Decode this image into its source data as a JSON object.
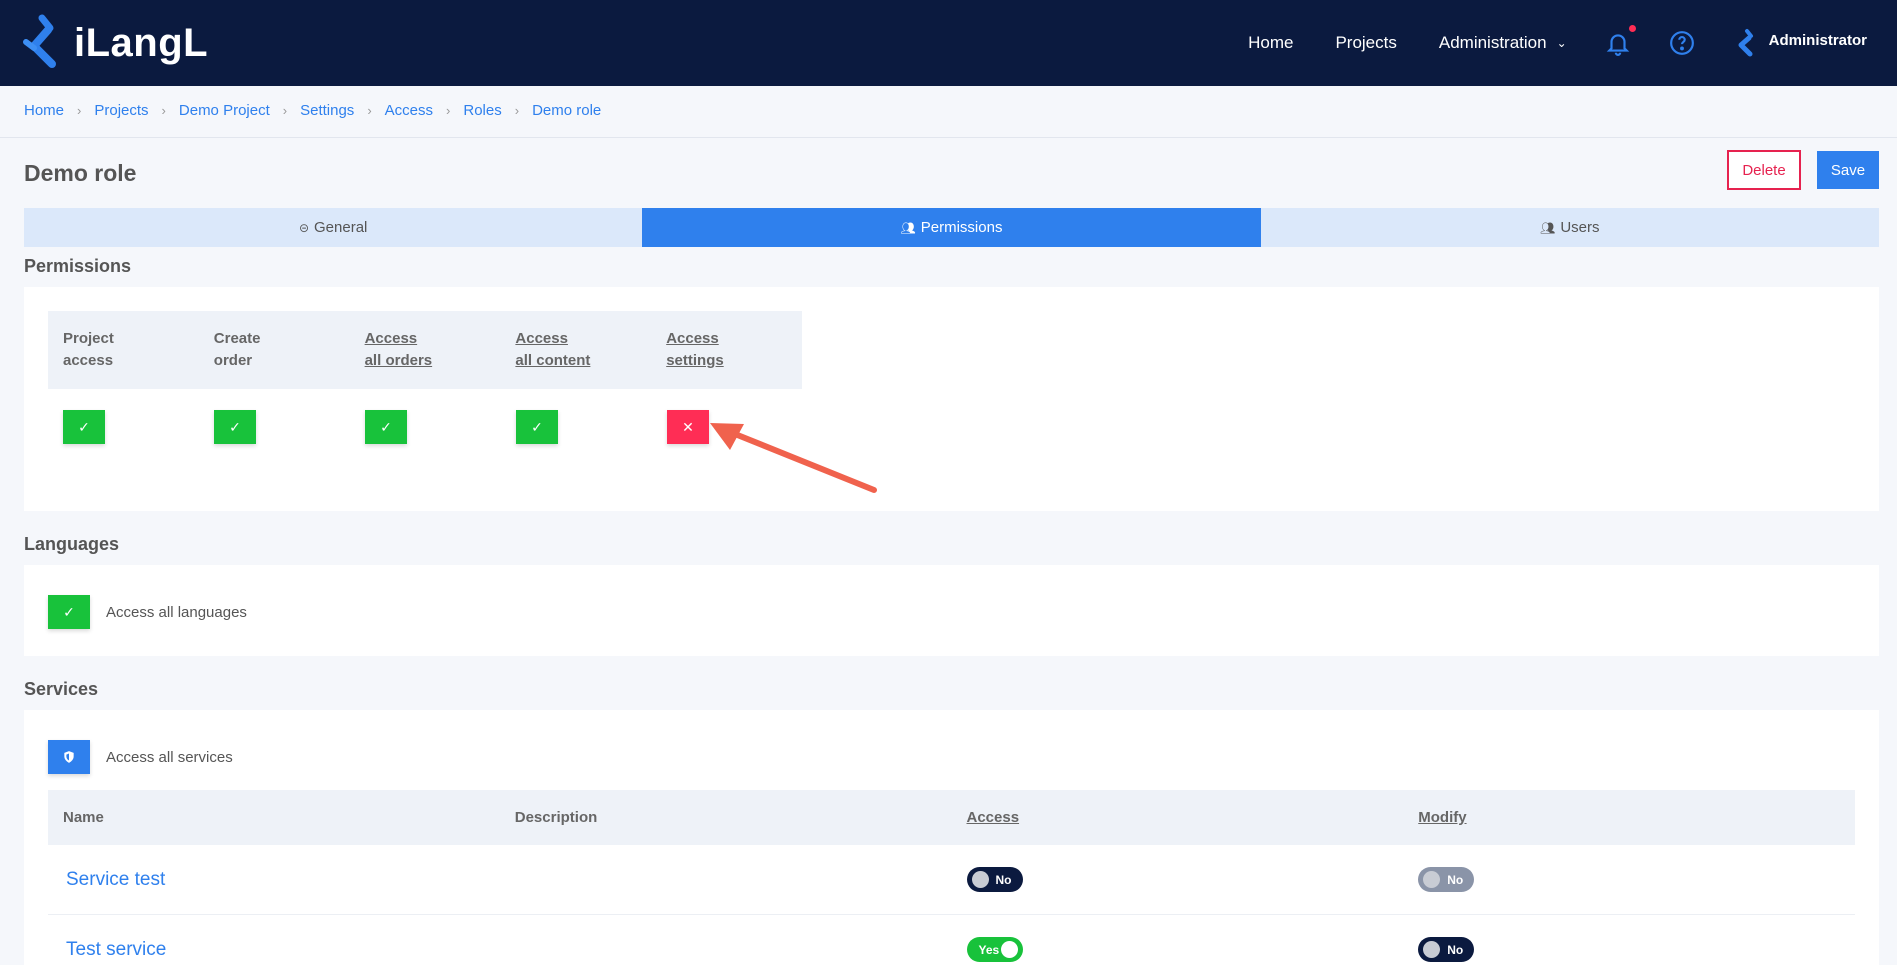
{
  "app": {
    "logo_text": "iLangL"
  },
  "nav": {
    "home": "Home",
    "projects": "Projects",
    "administration": "Administration",
    "user": "Administrator"
  },
  "breadcrumb": [
    "Home",
    "Projects",
    "Demo Project",
    "Settings",
    "Access",
    "Roles",
    "Demo role"
  ],
  "page": {
    "title": "Demo role",
    "delete_label": "Delete",
    "save_label": "Save"
  },
  "tabs": [
    {
      "label": "General",
      "active": false
    },
    {
      "label": "Permissions",
      "active": true
    },
    {
      "label": "Users",
      "active": false
    }
  ],
  "permissions": {
    "section_title": "Permissions",
    "columns": [
      {
        "line1": "Project",
        "line2": "access",
        "granted": true
      },
      {
        "line1": "Create",
        "line2": "order",
        "granted": true
      },
      {
        "line1": "Access",
        "line2": "all orders",
        "granted": true
      },
      {
        "line1": "Access",
        "line2": "all content",
        "granted": true
      },
      {
        "line1": "Access",
        "line2": "settings",
        "granted": false
      }
    ]
  },
  "languages": {
    "section_title": "Languages",
    "access_all_label": "Access all languages"
  },
  "services": {
    "section_title": "Services",
    "access_all_label": "Access all services",
    "headers": [
      "Name",
      "Description",
      "Access",
      "Modify"
    ],
    "rows": [
      {
        "name": "Service test",
        "description": "",
        "access": "No",
        "modify": "No"
      },
      {
        "name": "Test service",
        "description": "",
        "access": "Yes",
        "modify": "No"
      }
    ]
  },
  "colors": {
    "navy": "#0b1a3f",
    "primary": "#2f80ed",
    "success": "#18c23b",
    "danger": "#ff2d55",
    "annotation_arrow": "#f0624d"
  }
}
